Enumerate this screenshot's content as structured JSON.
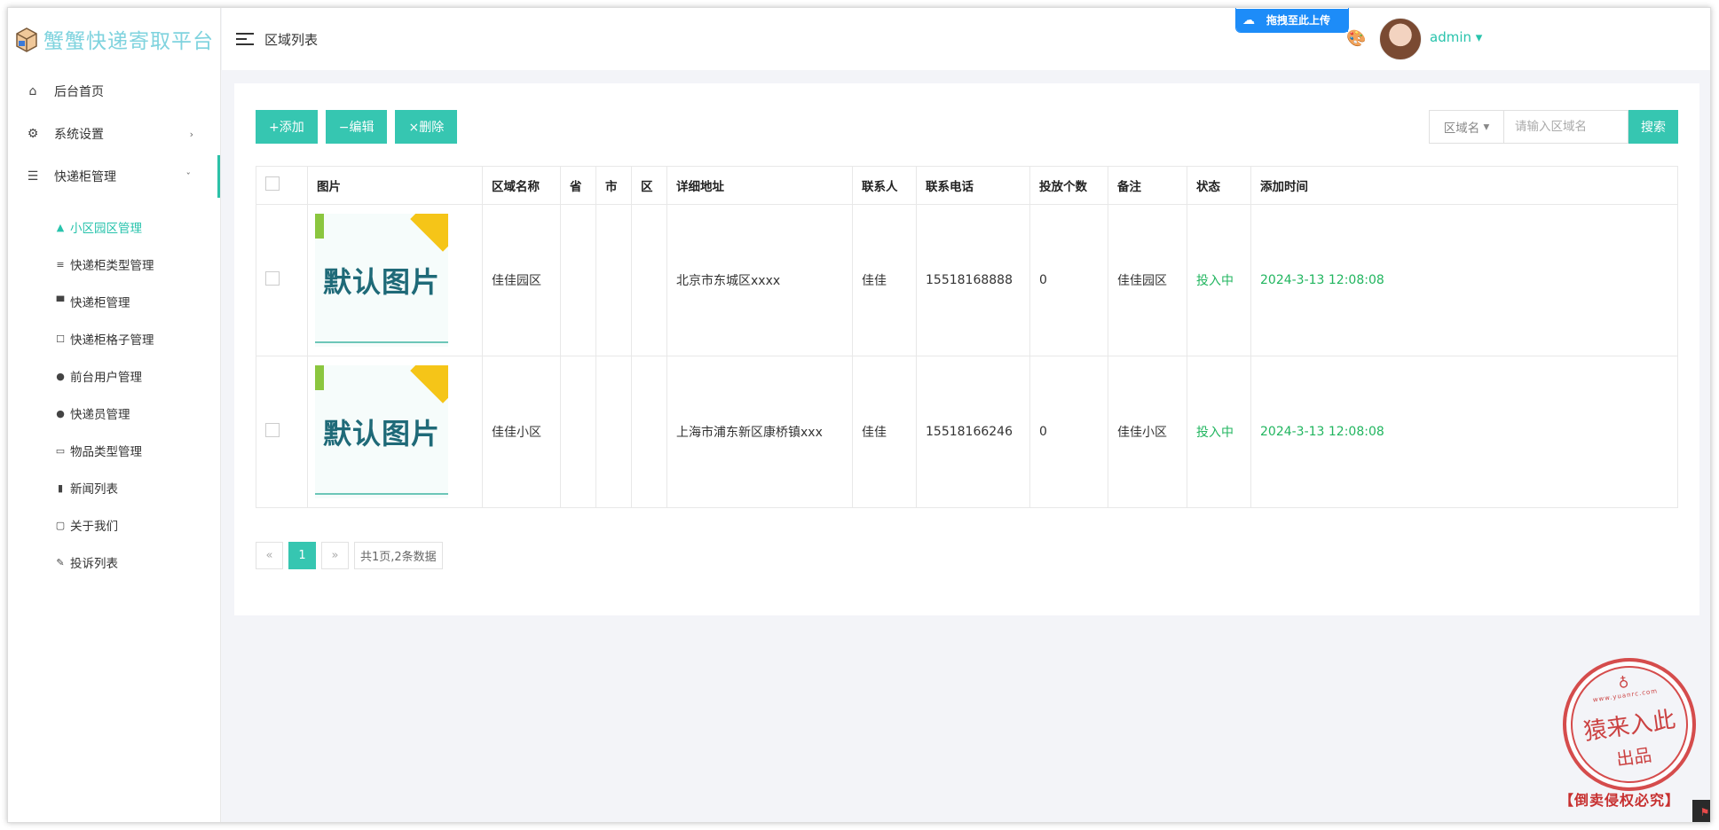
{
  "app": {
    "title": "蟹蟹快递寄取平台",
    "logo_icon": "package-box-icon",
    "brand_color": "#7fd3de",
    "accent_color": "#36c6b1"
  },
  "sidebar": {
    "items": [
      {
        "label": "后台首页",
        "icon": "home-icon"
      },
      {
        "label": "系统设置",
        "icon": "gear-icon",
        "chevron": "›"
      },
      {
        "label": "快递柜管理",
        "icon": "list-icon",
        "chevron": "ˇ"
      }
    ],
    "sub_items": [
      {
        "label": "小区园区管理",
        "icon": "tree-icon",
        "glyph": "▲"
      },
      {
        "label": "快递柜类型管理",
        "icon": "bars-icon",
        "glyph": "≡"
      },
      {
        "label": "快递柜管理",
        "icon": "card-icon",
        "glyph": "▀"
      },
      {
        "label": "快递柜格子管理",
        "icon": "square-icon",
        "glyph": "☐"
      },
      {
        "label": "前台用户管理",
        "icon": "user-icon",
        "glyph": "●"
      },
      {
        "label": "快递员管理",
        "icon": "user-icon",
        "glyph": "●"
      },
      {
        "label": "物品类型管理",
        "icon": "folder-icon",
        "glyph": "▭"
      },
      {
        "label": "新闻列表",
        "icon": "file-icon",
        "glyph": "▮"
      },
      {
        "label": "关于我们",
        "icon": "comment-icon",
        "glyph": "▢"
      },
      {
        "label": "投诉列表",
        "icon": "pencil-icon",
        "glyph": "✎"
      }
    ]
  },
  "header": {
    "page_title": "区域列表",
    "upload_badge": "拖拽至此上传",
    "user": "admin"
  },
  "toolbar": {
    "add_label": "+添加",
    "edit_label": "−编辑",
    "delete_label": "×删除"
  },
  "search": {
    "field_select": "区域名",
    "placeholder": "请输入区域名",
    "button": "搜索"
  },
  "table": {
    "headers": [
      "图片",
      "区域名称",
      "省",
      "市",
      "区",
      "详细地址",
      "联系人",
      "联系电话",
      "投放个数",
      "备注",
      "状态",
      "添加时间"
    ],
    "rows": [
      {
        "image_text": "默认图片",
        "name": "佳佳园区",
        "province": "",
        "city": "",
        "district": "",
        "address": "北京市东城区xxxx",
        "contact": "佳佳",
        "phone": "15518168888",
        "count": "0",
        "remark": "佳佳园区",
        "status": "投入中",
        "added": "2024-3-13 12:08:08"
      },
      {
        "image_text": "默认图片",
        "name": "佳佳小区",
        "province": "",
        "city": "",
        "district": "",
        "address": "上海市浦东新区康桥镇xxx",
        "contact": "佳佳",
        "phone": "15518166246",
        "count": "0",
        "remark": "佳佳小区",
        "status": "投入中",
        "added": "2024-3-13 12:08:08"
      }
    ]
  },
  "pager": {
    "prev": "«",
    "current": "1",
    "next": "»",
    "info": "共1页,2条数据"
  },
  "watermark": {
    "url": "www.yuanrc.com",
    "title": "猿来入此",
    "subtitle": "出品",
    "footer": "【倒卖侵权必究】"
  }
}
